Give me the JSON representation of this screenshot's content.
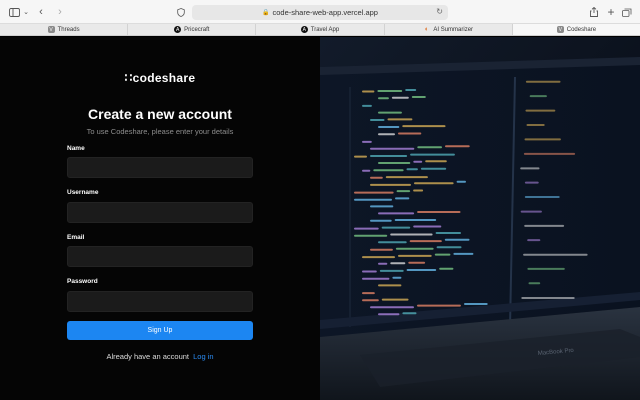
{
  "browser": {
    "url": "code-share-web-app.vercel.app",
    "tabs": [
      {
        "label": "Threads",
        "favicon": "V",
        "favicon_color": "#8a8a8a",
        "active": false
      },
      {
        "label": "Pricecraft",
        "favicon": "A",
        "favicon_color": "#111111",
        "active": false
      },
      {
        "label": "Travel App",
        "favicon": "A",
        "favicon_color": "#111111",
        "active": false
      },
      {
        "label": "AI Summarizer",
        "favicon": "◐",
        "favicon_color": "#e07b39",
        "active": false
      },
      {
        "label": "Codeshare",
        "favicon": "V",
        "favicon_color": "#8a8a8a",
        "active": true
      }
    ]
  },
  "signup": {
    "logo": "∷codeshare",
    "title": "Create a new account",
    "subtitle": "To use Codeshare, please enter your details",
    "fields": {
      "name": {
        "label": "Name",
        "value": ""
      },
      "username": {
        "label": "Username",
        "value": ""
      },
      "email": {
        "label": "Email",
        "value": ""
      },
      "password": {
        "label": "Password",
        "value": ""
      }
    },
    "submit_label": "Sign Up",
    "login_prompt": "Already have an account",
    "login_link": "Log in"
  },
  "image": {
    "laptop_brand": "MacBook Pro"
  },
  "colors": {
    "accent": "#1c86f2",
    "background": "#050505",
    "input_bg": "#1b1b1b"
  }
}
